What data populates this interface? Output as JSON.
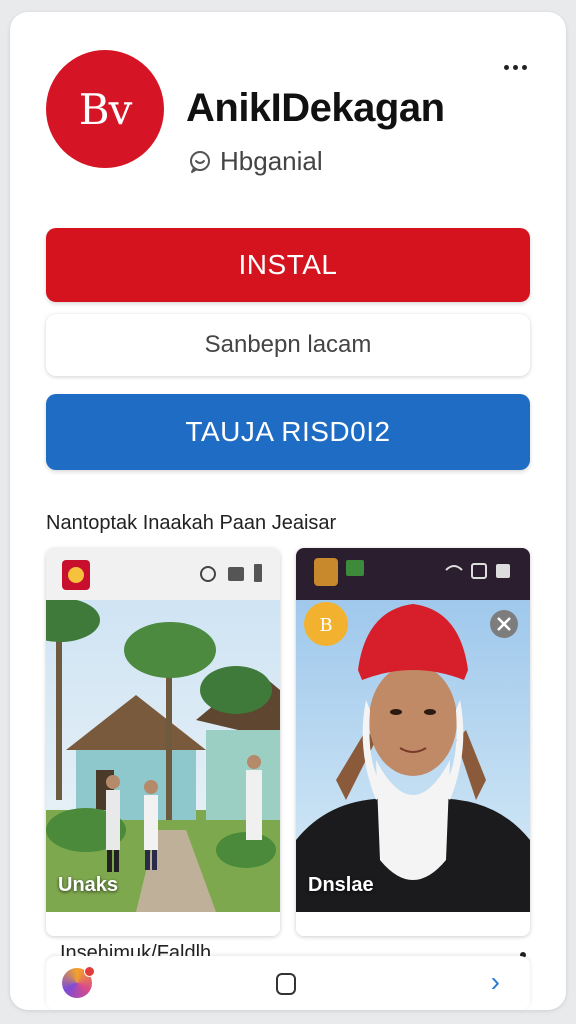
{
  "app": {
    "logo_text": "Bv",
    "title": "AnikIDekagan",
    "developer": "Hbganial",
    "brand_color": "#d51526"
  },
  "buttons": {
    "install_label": "INSTAL",
    "secondary_label": "Sanbepn lacam",
    "blue_label": "TAUJA RISD0I2",
    "blue_color": "#1f6cc5"
  },
  "screenshots": {
    "section_label": "Nantoptak Inaakah Paan Jeaisar",
    "items": [
      {
        "caption": "Unaks"
      },
      {
        "caption": "Dnslae"
      }
    ]
  },
  "bottom": {
    "text": "Insehimuk/Faldlh"
  },
  "icons": {
    "more": "more-vert-icon",
    "developer": "chat-bubble-icon",
    "nav_home": "home-square-icon",
    "nav_back": "chevron-right-icon"
  }
}
